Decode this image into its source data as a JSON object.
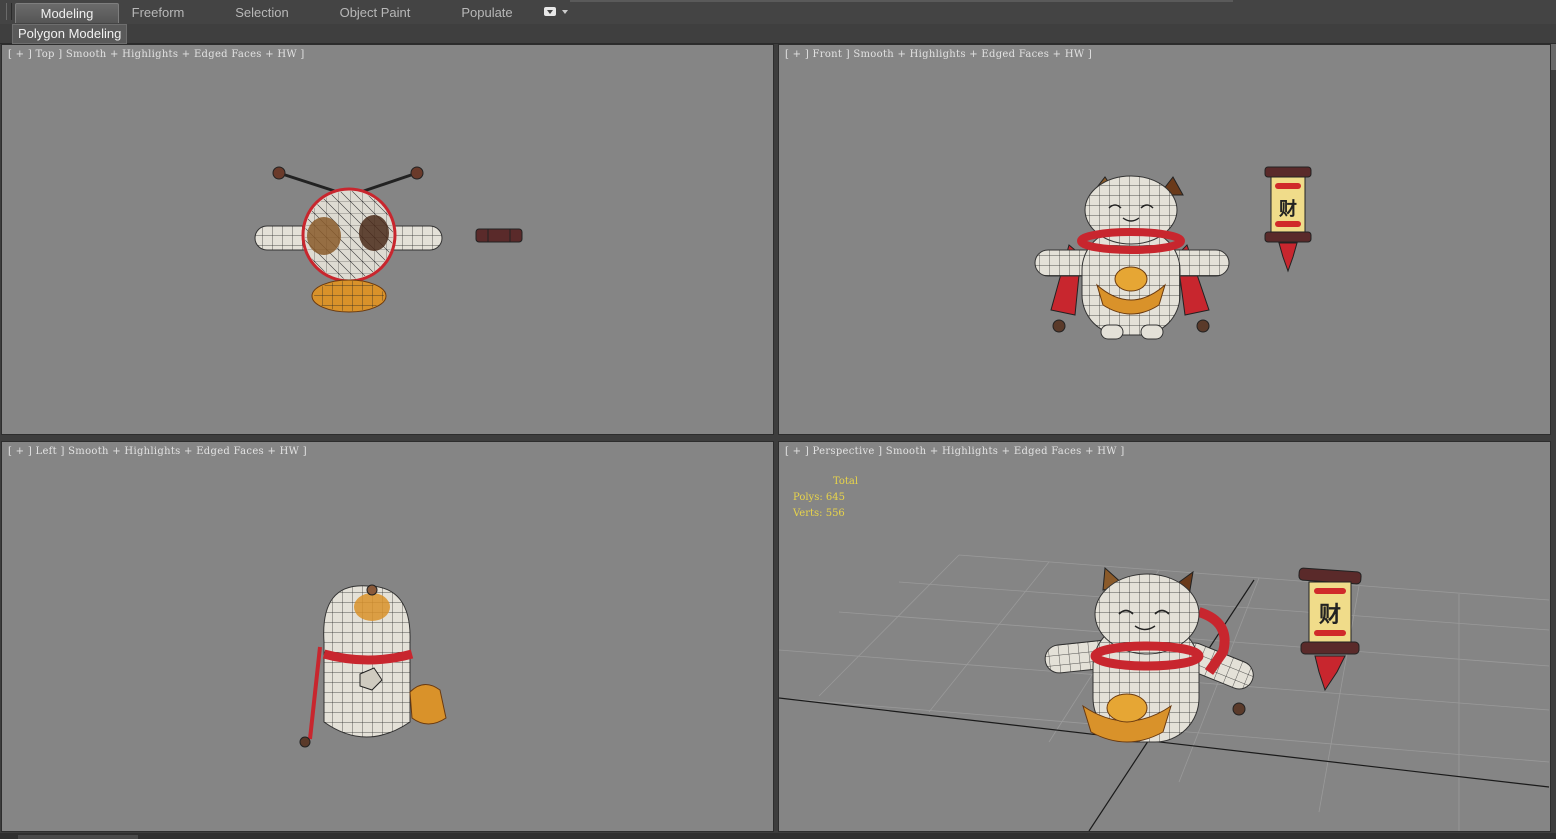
{
  "ribbon": {
    "tabs": [
      {
        "label": "Modeling",
        "active": true
      },
      {
        "label": "Freeform",
        "active": false
      },
      {
        "label": "Selection",
        "active": false
      },
      {
        "label": "Object Paint",
        "active": false
      },
      {
        "label": "Populate",
        "active": false
      }
    ],
    "options_icon": "ribbon-options-icon"
  },
  "subbar": {
    "label": "Polygon Modeling"
  },
  "viewports": {
    "top": {
      "label": "[ + ] Top ] Smooth + Highlights + Edged Faces + HW ]"
    },
    "front": {
      "label": "[ + ] Front ] Smooth + Highlights + Edged Faces + HW ]"
    },
    "left": {
      "label": "[ + ] Left ] Smooth + Highlights + Edged Faces + HW ]"
    },
    "perspective": {
      "label": "[ + ] Perspective ] Smooth + Highlights + Edged Faces + HW ]"
    }
  },
  "stats": {
    "header": "Total",
    "polys": "Polys: 645",
    "verts": "Verts: 556"
  },
  "scroll_glyph": "财",
  "colors": {
    "viewport_bg": "#858585",
    "stats_text": "#e8d44a",
    "mesh_white": "#e6e3da",
    "scarf_red": "#c8262e",
    "ingot_gold": "#d9922a"
  }
}
